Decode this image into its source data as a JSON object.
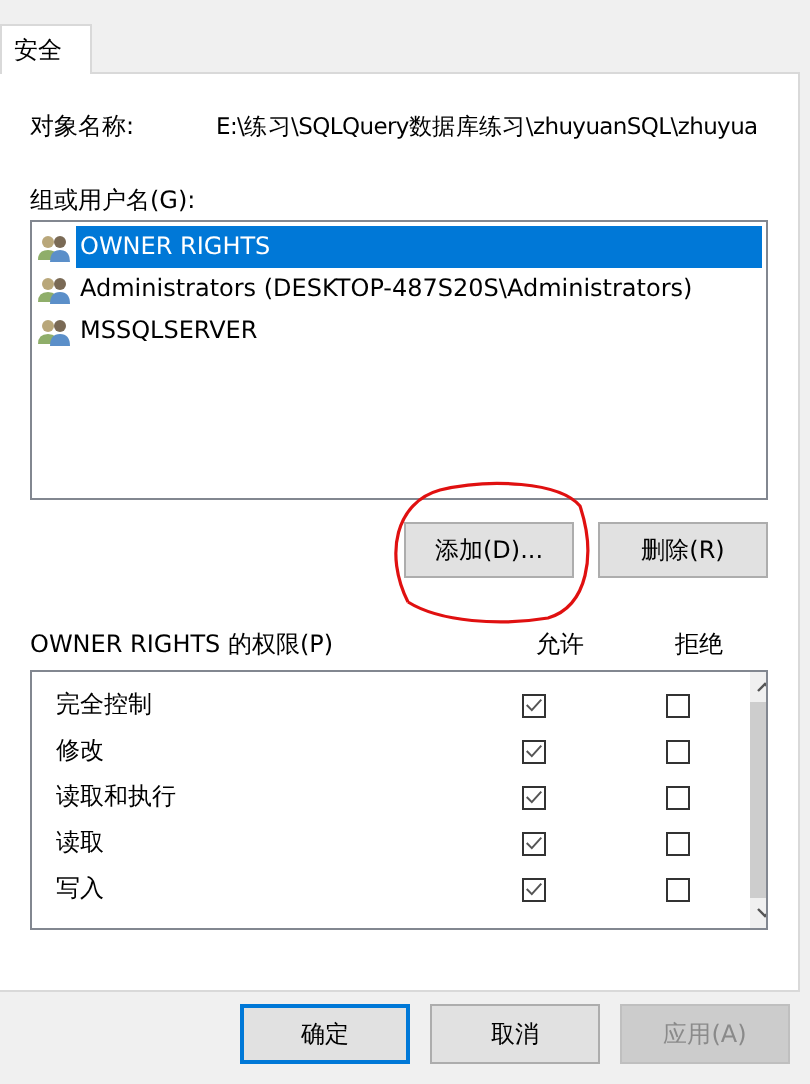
{
  "tabs": [
    {
      "label": "安全",
      "selected": true
    }
  ],
  "object_name": {
    "label": "对象名称:",
    "value": "E:\\练习\\SQLQuery数据库练习\\zhuyuanSQL\\zhuyua"
  },
  "groups": {
    "label": "组或用户名(G):",
    "items": [
      {
        "name": "OWNER RIGHTS",
        "selected": true
      },
      {
        "name": "Administrators (DESKTOP-487S20S\\Administrators)",
        "selected": false
      },
      {
        "name": "MSSQLSERVER",
        "selected": false
      }
    ]
  },
  "group_buttons": [
    {
      "label": "添加(D)..."
    },
    {
      "label": "删除(R)"
    }
  ],
  "annotation": {
    "kind": "circle"
  },
  "permissions": {
    "label": "OWNER RIGHTS 的权限(P)",
    "columns": [
      "允许",
      "拒绝"
    ],
    "rows": [
      {
        "name": "完全控制",
        "allow": true,
        "deny": false
      },
      {
        "name": "修改",
        "allow": true,
        "deny": false
      },
      {
        "name": "读取和执行",
        "allow": true,
        "deny": false
      },
      {
        "name": "读取",
        "allow": true,
        "deny": false
      },
      {
        "name": "写入",
        "allow": true,
        "deny": false
      }
    ]
  },
  "dialog_buttons": [
    {
      "label": "确定",
      "default": true,
      "disabled": false
    },
    {
      "label": "取消",
      "default": false,
      "disabled": false
    },
    {
      "label": "应用(A)",
      "default": false,
      "disabled": true
    }
  ]
}
